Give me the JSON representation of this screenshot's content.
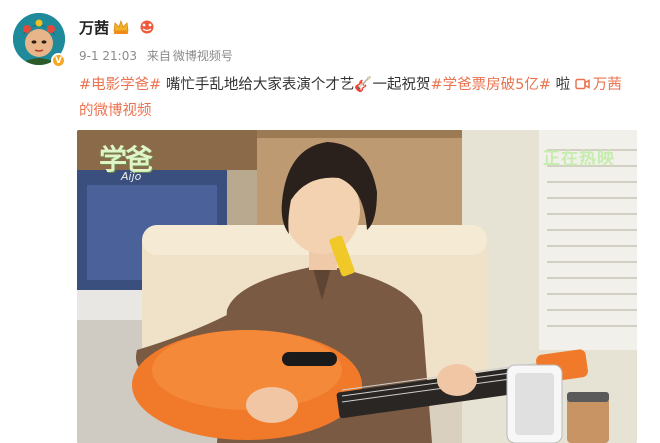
{
  "post": {
    "username": "万茜",
    "time": "9-1 21:03",
    "source_prefix": "来自",
    "source": "微博视频号",
    "tag_movie": "#电影学爸#",
    "text_main": " 嘴忙手乱地给大家表演个才艺🎸一起祝贺",
    "tag_boxoffice": "#学爸票房破5亿#",
    "text_la": " 啦 ",
    "video_link_line1": "万茜",
    "video_link_line2": "的微博视频"
  },
  "video": {
    "watermark_title": "学爸",
    "watermark_sub": "Aijo",
    "watermark_live": "正在热映"
  },
  "colors": {
    "accent": "#eb7350",
    "guitar": "#f07a2a",
    "shirt": "#7a5a43"
  }
}
